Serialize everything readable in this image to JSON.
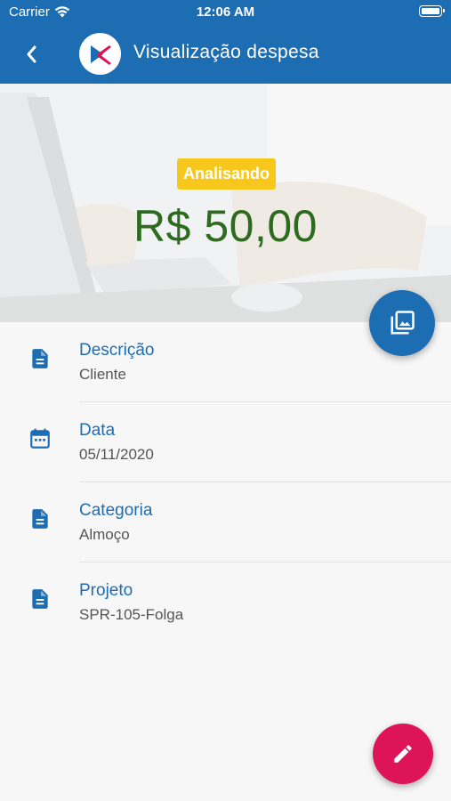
{
  "status_bar": {
    "carrier": "Carrier",
    "time": "12:06 AM"
  },
  "header": {
    "title": "Visualização despesa"
  },
  "expense": {
    "status": "Analisando",
    "amount": "R$ 50,00"
  },
  "details": [
    {
      "label": "Descrição",
      "value": " Cliente",
      "icon": "document-icon"
    },
    {
      "label": "Data",
      "value": "05/11/2020",
      "icon": "calendar-icon"
    },
    {
      "label": "Categoria",
      "value": "Almoço",
      "icon": "document-icon"
    },
    {
      "label": "Projeto",
      "value": "SPR-105-Folga",
      "icon": "document-icon"
    }
  ],
  "colors": {
    "primary": "#1d6db3",
    "badge": "#f7c81b",
    "amount": "#2d6b1e",
    "fab_edit": "#dd1457"
  }
}
